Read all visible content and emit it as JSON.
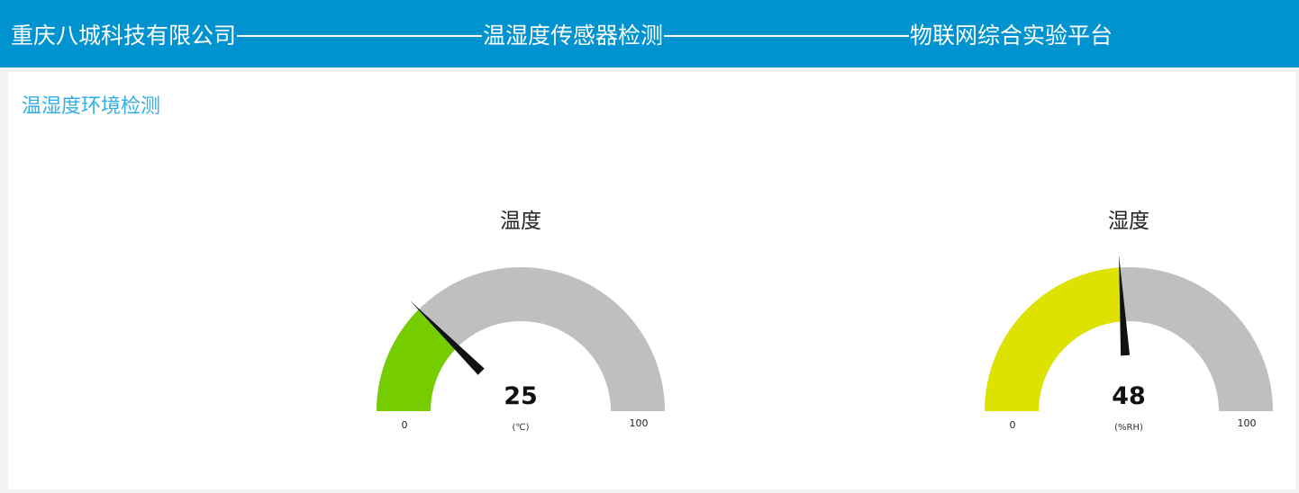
{
  "header": {
    "company": "重庆八城科技有限公司",
    "middle": "温湿度传感器检测",
    "right": "物联网综合实验平台",
    "bg_color": "#0093cf"
  },
  "panel": {
    "title": "温湿度环境检测"
  },
  "gauges": [
    {
      "title": "温度",
      "value": 25,
      "min": 0,
      "max": 100,
      "unit": "(℃)",
      "fill_color": "#75cd00",
      "track_color": "#bfbfbf"
    },
    {
      "title": "湿度",
      "value": 48,
      "min": 0,
      "max": 100,
      "unit": "(%RH)",
      "fill_color": "#dde200",
      "track_color": "#bfbfbf"
    }
  ]
}
